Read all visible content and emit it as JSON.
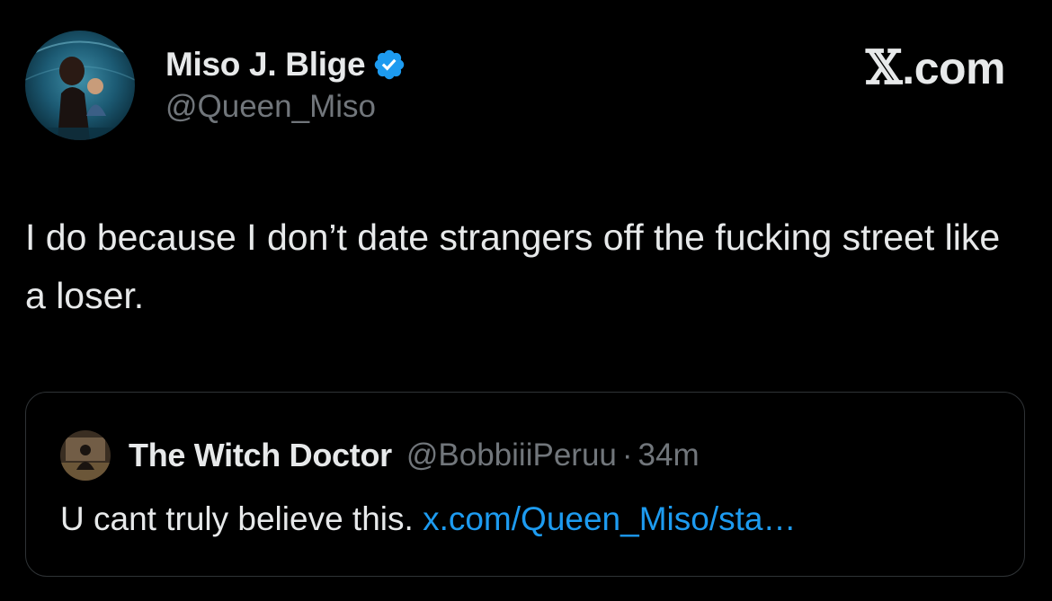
{
  "author": {
    "display_name": "Miso J. Blige",
    "handle": "@Queen_Miso",
    "verified": true,
    "verified_color": "#1d9bf0",
    "avatar_icon": "profile-photo"
  },
  "brand": {
    "logo_glyph": "𝕏",
    "label": ".com"
  },
  "tweet": {
    "text": "I do because I don’t date strangers off the fucking street like a loser."
  },
  "quoted_tweet": {
    "display_name": "The Witch Doctor",
    "handle": "@BobbiiiPeruu",
    "separator": "·",
    "time": "34m",
    "text": "U cant truly believe this.",
    "link": "x.com/Queen_Miso/sta…",
    "link_color": "#1d9bf0",
    "avatar_icon": "profile-photo"
  },
  "colors": {
    "background": "#000000",
    "primary_text": "#e7e9ea",
    "secondary_text": "#71767b",
    "border": "#2f3336"
  }
}
